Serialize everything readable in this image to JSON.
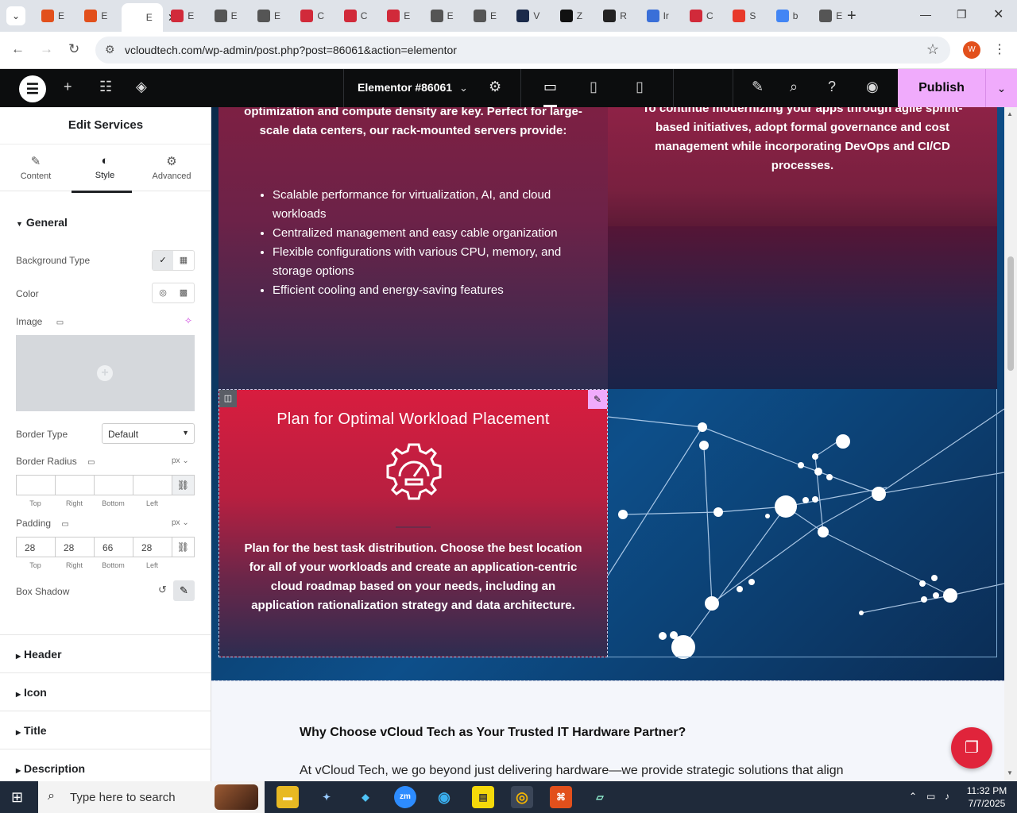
{
  "browser": {
    "tabs": [
      {
        "label": "E",
        "icon": "elementor-orange-icon",
        "color": "#e2501c"
      },
      {
        "label": "E",
        "icon": "elementor-orange-icon",
        "color": "#e2501c"
      },
      {
        "label": "E",
        "icon": "elementor-doc-icon",
        "active": true
      },
      {
        "label": "E",
        "icon": "diamond-red-icon",
        "color": "#d12a3a"
      },
      {
        "label": "E",
        "icon": "globe-icon",
        "color": "#555555"
      },
      {
        "label": "E",
        "icon": "globe-icon",
        "color": "#555555"
      },
      {
        "label": "C",
        "icon": "diamond-red-icon",
        "color": "#d12a3a"
      },
      {
        "label": "C",
        "icon": "diamond-red-icon",
        "color": "#d12a3a"
      },
      {
        "label": "E",
        "icon": "diamond-red-icon",
        "color": "#d12a3a"
      },
      {
        "label": "E",
        "icon": "globe-icon",
        "color": "#555555"
      },
      {
        "label": "E",
        "icon": "globe-icon",
        "color": "#555555"
      },
      {
        "label": "V",
        "icon": "v-logo-icon",
        "color": "#1b2a4a"
      },
      {
        "label": "Z",
        "icon": "z-logo-icon",
        "color": "#111111"
      },
      {
        "label": "R",
        "icon": "r-logo-icon",
        "color": "#222222"
      },
      {
        "label": "Ir",
        "icon": "bird-logo-icon",
        "color": "#3a6fd8"
      },
      {
        "label": "C",
        "icon": "scribble-logo-icon",
        "color": "#d12a3a"
      },
      {
        "label": "S",
        "icon": "circle-logo-icon",
        "color": "#e8392a"
      },
      {
        "label": "b",
        "icon": "google-icon",
        "color": "#4285f4"
      },
      {
        "label": "E",
        "icon": "globe-icon",
        "color": "#555555"
      }
    ],
    "url": "vcloudtech.com/wp-admin/post.php?post=86061&action=elementor",
    "profile_initial": "W"
  },
  "editor": {
    "doc_title": "Elementor #86061",
    "publish_label": "Publish"
  },
  "panel": {
    "title": "Edit Services",
    "tabs": [
      {
        "label": "Content",
        "icon": "pencil-icon"
      },
      {
        "label": "Style",
        "icon": "half-circle-icon",
        "active": true
      },
      {
        "label": "Advanced",
        "icon": "gear-icon"
      }
    ],
    "general_label": "General",
    "background_type_label": "Background Type",
    "color_label": "Color",
    "image_label": "Image",
    "border_type_label": "Border Type",
    "border_type_value": "Default",
    "border_radius_label": "Border Radius",
    "unit_label": "px",
    "border_radius_values": [
      "",
      "",
      "",
      ""
    ],
    "padding_label": "Padding",
    "padding_values": [
      "28",
      "28",
      "66",
      "28"
    ],
    "dim_labels": [
      "Top",
      "Right",
      "Bottom",
      "Left"
    ],
    "box_shadow_label": "Box Shadow",
    "collapsed_sections": [
      "Header",
      "Icon",
      "Title",
      "Description"
    ]
  },
  "canvas": {
    "card1_text": "optimization and compute density are key. Perfect for large-scale data centers, our rack-mounted servers provide:",
    "card1_bullets": [
      "Scalable performance for virtualization, AI, and cloud workloads",
      "Centralized management and easy cable organization",
      "Flexible configurations with various CPU, memory, and storage options",
      "Efficient cooling and energy-saving features"
    ],
    "card2_text": "To continue modernizing your apps through agile sprint-based initiatives, adopt formal governance and cost management while incorporating DevOps and CI/CD processes.",
    "card3_title": "Plan for Optimal Workload Placement",
    "card3_desc": "Plan for the best task distribution. Choose the best location for all of your workloads and create an application-centric cloud roadmap based on your needs, including an application rationalization strategy and data architecture.",
    "why_heading": "Why Choose vCloud Tech as Your Trusted IT Hardware Partner?",
    "why_text": "At vCloud Tech, we go beyond just delivering hardware—we provide strategic solutions that align"
  },
  "taskbar": {
    "search_placeholder": "Type here to search",
    "time": "11:32 PM",
    "date": "7/7/2025"
  },
  "colors": {
    "accent": "#f0abfc",
    "chat": "#e0243b"
  }
}
